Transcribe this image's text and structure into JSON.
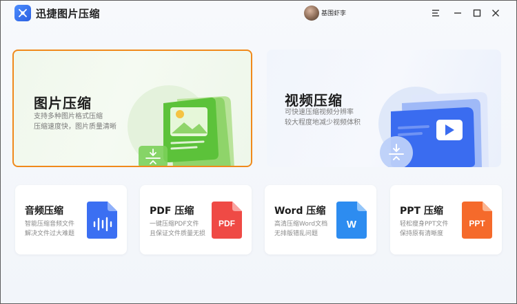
{
  "app": {
    "title": "迅捷图片压缩",
    "username": "基围虾李"
  },
  "cards": {
    "image": {
      "title": "图片压缩",
      "desc_line1": "支持多种图片格式压缩",
      "desc_line2": "压缩速度快，图片质量清晰"
    },
    "video": {
      "title": "视频压缩",
      "desc_line1": "可快速压缩视频分辨率",
      "desc_line2": "较大程度地减少视频体积"
    }
  },
  "tools": [
    {
      "title": "音频压缩",
      "desc_line1": "智能压缩音频文件",
      "desc_line2": "解决文件过大难题",
      "icon_label": ""
    },
    {
      "title": "PDF 压缩",
      "desc_line1": "一键压缩PDF文件",
      "desc_line2": "且保证文件质量无损",
      "icon_label": "PDF"
    },
    {
      "title": "Word 压缩",
      "desc_line1": "高清压缩Word文档",
      "desc_line2": "无排版错乱问题",
      "icon_label": "W"
    },
    {
      "title": "PPT 压缩",
      "desc_line1": "轻松瘦身PPT文件",
      "desc_line2": "保持原有清晰度",
      "icon_label": "PPT"
    }
  ],
  "colors": {
    "accent_border": "#f0891a",
    "image_green": "#5cc23a",
    "video_blue": "#3a6cf0",
    "audio_blue": "#3b6ff2",
    "pdf_red": "#ef4a45",
    "word_blue": "#2d8cf0",
    "ppt_orange": "#f56a2b"
  }
}
